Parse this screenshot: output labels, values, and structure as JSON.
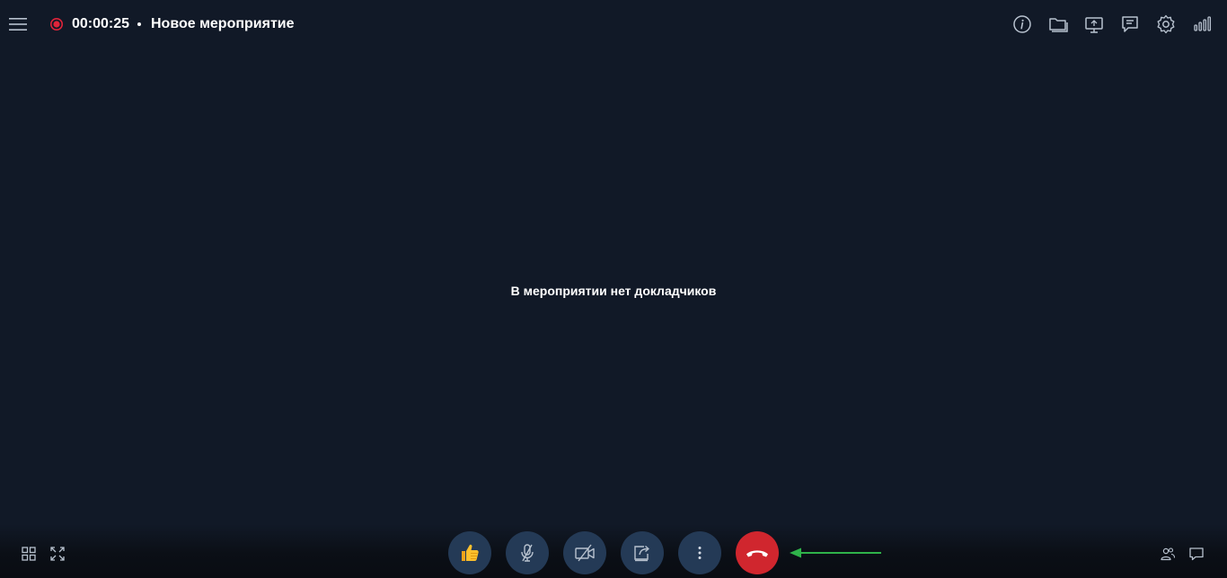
{
  "header": {
    "timer": "00:00:25",
    "title": "Новое мероприятие",
    "icons": [
      "info-icon",
      "folder-icon",
      "screen-share-icon",
      "chat-icon",
      "settings-icon",
      "network-signal-icon"
    ]
  },
  "main": {
    "message": "В мероприятии нет докладчиков"
  },
  "footer": {
    "left_icons": [
      "grid-layout-icon",
      "fullscreen-icon"
    ],
    "controls": [
      "thumbs-up-reaction",
      "microphone-off",
      "camera-off",
      "share-screen",
      "more-options",
      "hang-up"
    ],
    "right_icons": [
      "participants-icon",
      "chat-bubble-icon"
    ]
  },
  "colors": {
    "background": "#111927",
    "button": "#243a56",
    "hangup": "#d0262e",
    "record": "#e0243a",
    "arrow": "#2fb34a",
    "icon": "#b8c2cf"
  }
}
